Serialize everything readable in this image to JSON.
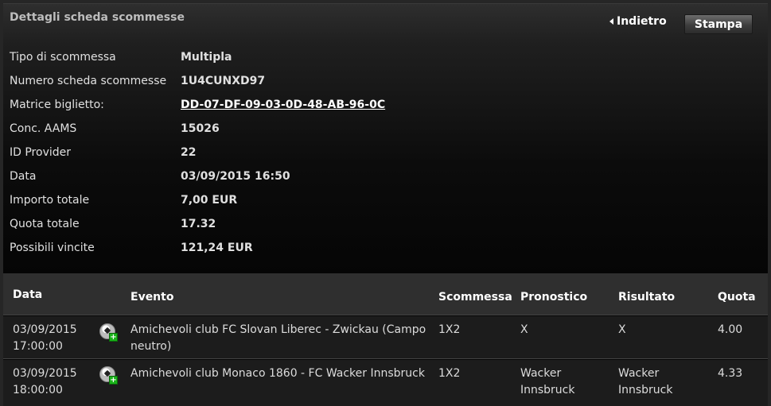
{
  "header": {
    "title": "Dettagli scheda scommesse",
    "back_label": "Indietro",
    "print_label": "Stampa"
  },
  "details": [
    {
      "label": "Tipo di scommessa",
      "value": "Multipla"
    },
    {
      "label": "Numero scheda scommesse",
      "value": "1U4CUNXD97"
    },
    {
      "label": "Matrice biglietto:",
      "value": "DD-07-DF-09-03-0D-48-AB-96-0C"
    },
    {
      "label": "Conc. AAMS",
      "value": "15026"
    },
    {
      "label": "ID Provider",
      "value": "22"
    },
    {
      "label": "Data",
      "value": "03/09/2015 16:50"
    },
    {
      "label": "Importo totale",
      "value": "7,00 EUR"
    },
    {
      "label": "Quota totale",
      "value": "17.32"
    },
    {
      "label": "Possibili vincite",
      "value": "121,24 EUR"
    }
  ],
  "table": {
    "headers": {
      "date": "Data",
      "event": "Evento",
      "bet": "Scommessa",
      "prediction": "Pronostico",
      "result": "Risultato",
      "odds": "Quota"
    },
    "rows": [
      {
        "date": "03/09/2015",
        "time": "17:00:00",
        "event": "Amichevoli club FC Slovan Liberec - Zwickau (Campo neutro)",
        "bet": "1X2",
        "prediction": "X",
        "result": "X",
        "odds": "4.00",
        "icon": "soccer-ball-icon"
      },
      {
        "date": "03/09/2015",
        "time": "18:00:00",
        "event": "Amichevoli club Monaco 1860 - FC Wacker Innsbruck",
        "bet": "1X2",
        "prediction": "Wacker Innsbruck",
        "result": "Wacker Innsbruck",
        "odds": "4.33",
        "icon": "soccer-ball-icon"
      }
    ]
  }
}
